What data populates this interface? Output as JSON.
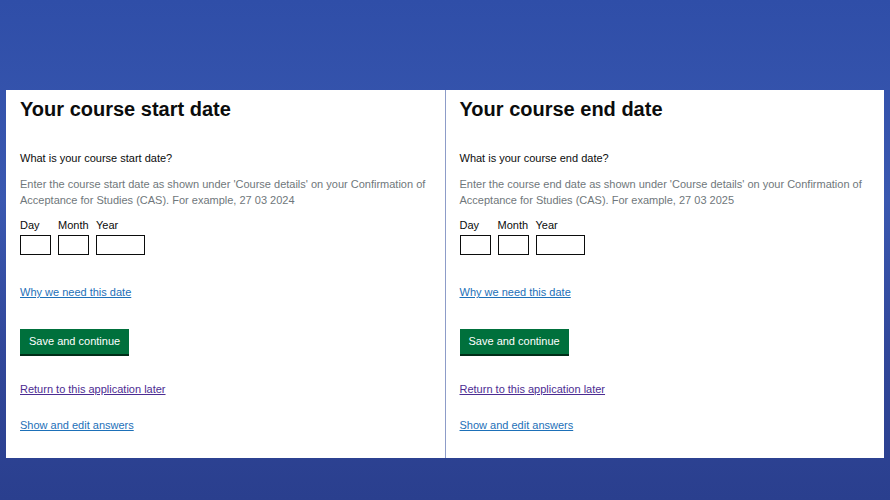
{
  "panels": [
    {
      "title": "Your course start date",
      "question": "What is your course start date?",
      "hint": "Enter the course start date as shown under 'Course details' on your Confirmation of Acceptance for Studies (CAS). For example, 27 03 2024",
      "fields": [
        {
          "label": "Day"
        },
        {
          "label": "Month"
        },
        {
          "label": "Year"
        }
      ],
      "help_link": "Why we need this date",
      "button": "Save and continue",
      "links": [
        {
          "text": "Return to this application later",
          "visited": true
        },
        {
          "text": "Show and edit answers",
          "visited": false
        }
      ]
    },
    {
      "title": "Your course end date",
      "question": "What is your course end date?",
      "hint": "Enter the course end date as shown under 'Course details' on your Confirmation of Acceptance for Studies (CAS). For example, 27 03 2025",
      "fields": [
        {
          "label": "Day"
        },
        {
          "label": "Month"
        },
        {
          "label": "Year"
        }
      ],
      "help_link": "Why we need this date",
      "button": "Save and continue",
      "links": [
        {
          "text": "Return to this application later",
          "visited": true
        },
        {
          "text": "Show and edit answers",
          "visited": false
        }
      ]
    }
  ]
}
